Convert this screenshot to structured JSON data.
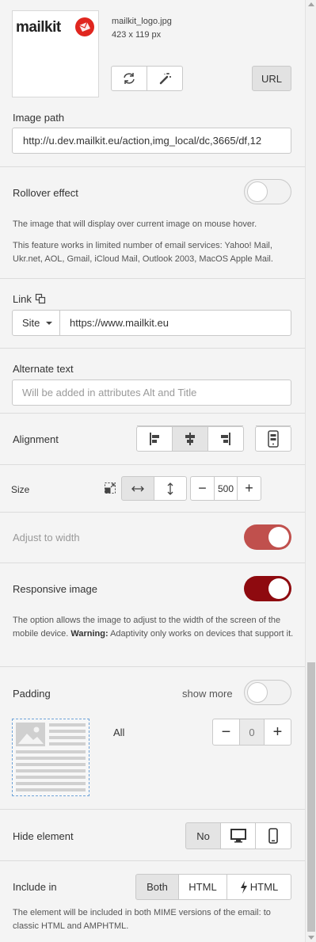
{
  "image": {
    "logo_text": "mailkit",
    "filename": "mailkit_logo.jpg",
    "dimensions": "423 x 119 px",
    "url_button": "URL",
    "icons": [
      "refresh-icon",
      "magic-wand-icon"
    ]
  },
  "image_path": {
    "label": "Image path",
    "value": "http://u.dev.mailkit.eu/action,img_local/dc,3665/df,12"
  },
  "rollover": {
    "label": "Rollover effect",
    "enabled": false,
    "help1": "The image that will display over current image on mouse hover.",
    "help2": "This feature works in limited number of email services: Yahoo! Mail, Ukr.net, AOL, Gmail, iCloud Mail, Outlook 2003, MacOS Apple Mail."
  },
  "link": {
    "label": "Link",
    "type": "Site",
    "value": "https://www.mailkit.eu"
  },
  "alt_text": {
    "label": "Alternate text",
    "placeholder": "Will be added in attributes Alt and Title"
  },
  "alignment": {
    "label": "Alignment",
    "options": [
      "align-left",
      "align-center",
      "align-right"
    ],
    "selected": "align-center"
  },
  "size": {
    "label": "Size",
    "value": "500",
    "minus": "−",
    "plus": "+"
  },
  "adjust_width": {
    "label": "Adjust to width",
    "enabled": true
  },
  "responsive": {
    "label": "Responsive image",
    "enabled": true,
    "help_pre": "The option allows the image to adjust to the width of the screen of the mobile device. ",
    "help_bold": "Warning:",
    "help_post": " Adaptivity only works on devices that support it."
  },
  "padding": {
    "label": "Padding",
    "show_more": "show more",
    "show_more_enabled": false,
    "all_label": "All",
    "value": "0",
    "minus": "−",
    "plus": "+"
  },
  "hide_element": {
    "label": "Hide element",
    "options": [
      "No",
      "desktop",
      "mobile"
    ],
    "selected": "No"
  },
  "include_in": {
    "label": "Include in",
    "options": [
      "Both",
      "HTML",
      "HTML"
    ],
    "selected": "Both",
    "help": "The element will be included in both MIME versions of the email: to classic HTML and AMPHTML."
  },
  "colors": {
    "brand_red": "#e0261f",
    "toggle_on_light": "#c0504d",
    "toggle_on_dark": "#8e0a0f"
  }
}
